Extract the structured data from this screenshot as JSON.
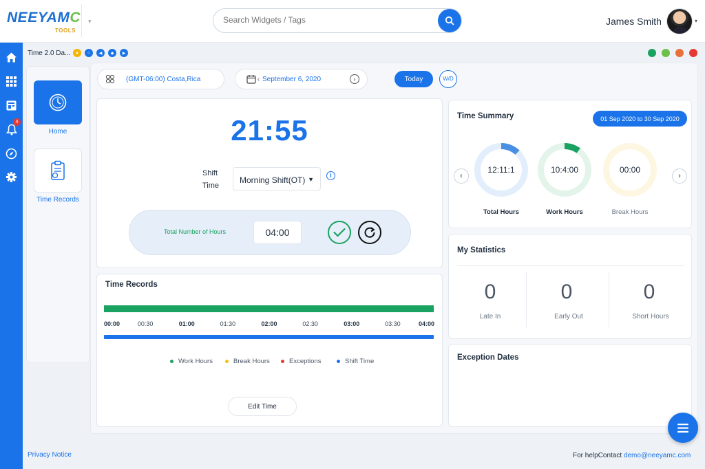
{
  "header": {
    "logo_text": "NEEYAMC",
    "logo_sub": "TOOLS",
    "search_placeholder": "Search Widgets / Tags",
    "user_name": "James Smith"
  },
  "sidebar": {
    "notification_count": "4",
    "items": [
      "home-icon",
      "grid-icon",
      "dashboard-icon",
      "bell-icon",
      "compass-icon",
      "gear-icon"
    ]
  },
  "breadcrumb": {
    "title": "Time 2.0 Da..."
  },
  "left_nav": {
    "items": [
      {
        "label": "Home",
        "icon": "clock-icon"
      },
      {
        "label": "Time Records",
        "icon": "clipboard-icon"
      }
    ]
  },
  "filters": {
    "timezone": "(GMT-06:00) Costa,Rica",
    "date": "September 6, 2020",
    "today_label": "Today",
    "wd_label": "W/D"
  },
  "clock_panel": {
    "time": "21:55",
    "shift_label_1": "Shift",
    "shift_label_2": "Time",
    "shift_value": "Morning Shift(OT)",
    "total_label": "Total Number of Hours",
    "total_value": "04:00"
  },
  "time_records": {
    "title": "Time Records",
    "ticks": [
      "00:00",
      "00:30",
      "01:00",
      "01:30",
      "02:00",
      "02:30",
      "03:00",
      "03:30",
      "04:00"
    ],
    "legend": [
      {
        "label": "Work Hours",
        "color": "#1aa260"
      },
      {
        "label": "Break Hours",
        "color": "#f4c20d"
      },
      {
        "label": "Exceptions",
        "color": "#e53935"
      },
      {
        "label": "Shift Time",
        "color": "#1a73e8"
      }
    ],
    "edit_label": "Edit Time"
  },
  "time_summary": {
    "title": "Time Summary",
    "range": "01 Sep 2020 to 30 Sep 2020",
    "rings": [
      {
        "value": "12:11:1",
        "label": "Total Hours",
        "color": "#4a90e2",
        "fraction": 0.12
      },
      {
        "value": "10:4:00",
        "label": "Work Hours",
        "color": "#1aa260",
        "fraction": 0.1
      },
      {
        "value": "00:00",
        "label": "Break Hours",
        "color": "#f4c20d",
        "fraction": 0
      }
    ]
  },
  "statistics": {
    "title": "My Statistics",
    "items": [
      {
        "value": "0",
        "label": "Late In"
      },
      {
        "value": "0",
        "label": "Early Out"
      },
      {
        "value": "0",
        "label": "Short Hours"
      }
    ]
  },
  "exceptions": {
    "title": "Exception Dates"
  },
  "footer": {
    "privacy": "Privacy Notice",
    "help_prefix": "For helpContact",
    "help_email": "demo@neeyamc.com"
  }
}
